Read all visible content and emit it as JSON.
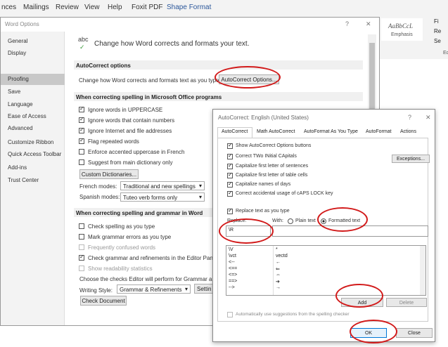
{
  "ribbon": {
    "tabs": [
      "nces",
      "Mailings",
      "Review",
      "View",
      "Help",
      "Foxit PDF",
      "Shape Format"
    ],
    "active_tab": "Shape Format",
    "style_preview": "AaBbCcL",
    "style_name": "Emphasis",
    "right_letters": [
      "Fi",
      "Re",
      "Se"
    ],
    "edge_letters": "Ed"
  },
  "word_options": {
    "title": "Word Options",
    "help": "?",
    "close": "✕",
    "sidebar": [
      "General",
      "Display",
      "Proofing",
      "Save",
      "Language",
      "Ease of Access",
      "Advanced",
      "Customize Ribbon",
      "Quick Access Toolbar",
      "Add-ins",
      "Trust Center"
    ],
    "selected": "Proofing",
    "header_icon": "abc",
    "header_text": "Change how Word corrects and formats your text.",
    "autocorrect_section": "AutoCorrect options",
    "autocorrect_desc": "Change how Word corrects and formats text as you type:",
    "autocorrect_btn": "AutoCorrect Options...",
    "spelling_section": "When correcting spelling in Microsoft Office programs",
    "spelling_opts": [
      {
        "label": "Ignore words in UPPERCASE",
        "checked": true
      },
      {
        "label": "Ignore words that contain numbers",
        "checked": true
      },
      {
        "label": "Ignore Internet and file addresses",
        "checked": true
      },
      {
        "label": "Flag repeated words",
        "checked": true
      },
      {
        "label": "Enforce accented uppercase in French",
        "checked": false
      },
      {
        "label": "Suggest from main dictionary only",
        "checked": false
      }
    ],
    "custom_dict_btn": "Custom Dictionaries...",
    "french_label": "French modes:",
    "french_value": "Traditional and new spellings",
    "spanish_label": "Spanish modes:",
    "spanish_value": "Tuteo verb forms only",
    "grammar_section": "When correcting spelling and grammar in Word",
    "grammar_opts": [
      {
        "label": "Check spelling as you type",
        "checked": false
      },
      {
        "label": "Mark grammar errors as you type",
        "checked": false
      },
      {
        "label": "Frequently confused words",
        "checked": false
      },
      {
        "label": "Check grammar and refinements in the Editor Pane",
        "checked": true
      },
      {
        "label": "Show readability statistics",
        "checked": false
      }
    ],
    "choose_text": "Choose the checks Editor will perform for Grammar and",
    "writing_style_label": "Writing Style:",
    "writing_style_value": "Grammar & Refinements",
    "settings_btn": "Settin",
    "check_doc_btn": "Check Document"
  },
  "autocorrect": {
    "title": "AutoCorrect: English (United States)",
    "help": "?",
    "close": "✕",
    "tabs": [
      "AutoCorrect",
      "Math AutoCorrect",
      "AutoFormat As You Type",
      "AutoFormat",
      "Actions"
    ],
    "active_tab": "AutoCorrect",
    "show_buttons": "Show AutoCorrect Options buttons",
    "options": [
      "Correct TWo INitial CApitals",
      "Capitalize first letter of sentences",
      "Capitalize first letter of table cells",
      "Capitalize names of days",
      "Correct accidental usage of cAPS LOCK key"
    ],
    "exceptions_btn": "Exceptions...",
    "replace_as_type": "Replace text as you type",
    "replace_label": "Replace:",
    "with_label": "With:",
    "plain_text": "Plain text",
    "formatted_text": "Formatted text",
    "replace_value": "\\R",
    "entries": [
      {
        "from": "\\V",
        "to": "*"
      },
      {
        "from": "\\vct",
        "to": "vectd"
      },
      {
        "from": "<--",
        "to": "←"
      },
      {
        "from": "<==",
        "to": "⇐"
      },
      {
        "from": "<=>",
        "to": "⇔"
      },
      {
        "from": "==>",
        "to": "➔"
      },
      {
        "from": "-->",
        "to": "→"
      }
    ],
    "add_btn": "Add",
    "delete_btn": "Delete",
    "auto_suggest": "Automatically use suggestions from the spelling checker",
    "ok_btn": "OK",
    "close_btn": "Close"
  }
}
